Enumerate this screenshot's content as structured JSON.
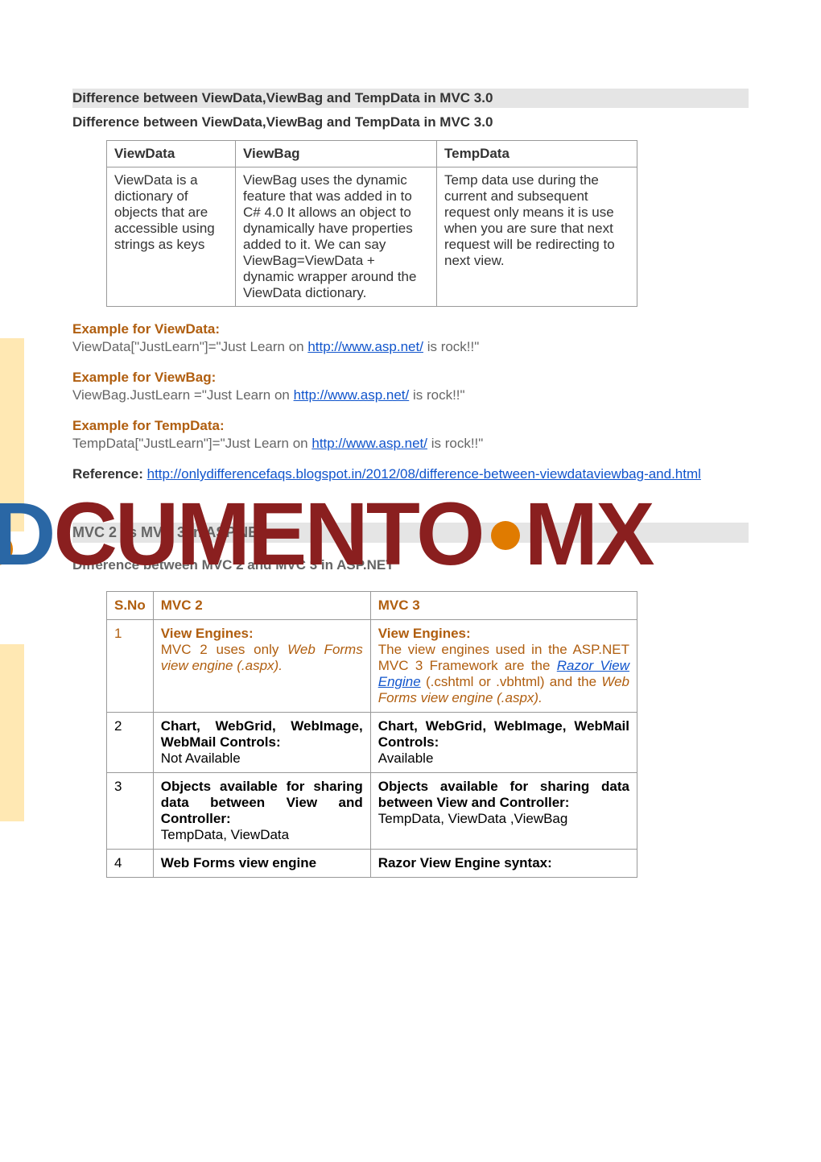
{
  "heading1": "Difference between ViewData,ViewBag and TempData in MVC 3.0",
  "subheading1": "Difference between ViewData,ViewBag and TempData in MVC 3.0",
  "table1": {
    "headers": [
      "ViewData",
      "ViewBag",
      "TempData"
    ],
    "cells": [
      "ViewData is a dictionary of objects that are accessible using strings as keys",
      "ViewBag uses the dynamic feature that was added in to C# 4.0 It allows an object to dynamically have properties added to it. We can say ViewBag=ViewData + dynamic wrapper around the ViewData dictionary.",
      "Temp data use during the current and subsequent request only means it is use when you are sure that next request will be redirecting to next view."
    ]
  },
  "ex_viewdata_label": "Example for ViewData:",
  "ex_viewdata_pre": "ViewData[\"JustLearn\"]=\"Just Learn on ",
  "ex_viewdata_link": "http://www.asp.net/",
  "ex_viewdata_post": " is rock!!\"",
  "ex_viewbag_label": "Example for ViewBag:",
  "ex_viewbag_pre": "ViewBag.JustLearn =\"Just Learn on ",
  "ex_viewbag_link": "http://www.asp.net/",
  "ex_viewbag_post": " is rock!!\"",
  "ex_tempdata_label": "Example for TempData:",
  "ex_tempdata_pre": "TempData[\"JustLearn\"]=\"Just Learn on ",
  "ex_tempdata_link": "http://www.asp.net/",
  "ex_tempdata_post": " is rock!!\"",
  "ref_label": "Reference: ",
  "ref_link": "http://onlydifferencefaqs.blogspot.in/2012/08/difference-between-viewdataviewbag-and.html",
  "heading2": "MVC 2 vs MVC 3 in ASP.NET",
  "subheading2": "Difference between MVC 2 and MVC 3 in ASP.NET",
  "table2": {
    "headers": [
      "S.No",
      "MVC 2",
      "MVC 3"
    ],
    "rows": [
      {
        "sno": "1",
        "mvc2_bold": "View Engines:",
        "mvc2_text1": "MVC 2 uses only ",
        "mvc2_italic1": "Web Forms view engine (.aspx).",
        "mvc3_bold": "View Engines:",
        "mvc3_text1": "The view engines used in the ASP.NET MVC 3 Framework are the ",
        "mvc3_link1": "Razor View Engine",
        "mvc3_text2": " (.cshtml or .vbhtml) and the ",
        "mvc3_italic1": "Web Forms view engine (.aspx)."
      },
      {
        "sno": "2",
        "mvc2_bold": "Chart, WebGrid, WebImage, WebMail Controls:",
        "mvc2_text1": "Not Available",
        "mvc3_bold": "Chart, WebGrid, WebImage, WebMail Controls:",
        "mvc3_text1": "Available"
      },
      {
        "sno": "3",
        "mvc2_bold": "Objects available for sharing data between View and Controller:",
        "mvc2_text1": "TempData, ViewData",
        "mvc3_bold": "Objects available for sharing data between View and Controller:",
        "mvc3_text1": "TempData, ViewData ,ViewBag"
      },
      {
        "sno": "4",
        "mvc2_bold": "Web Forms view engine",
        "mvc3_bold": "Razor View Engine syntax:"
      }
    ]
  },
  "watermark": {
    "d": "D",
    "rest": "CUMENTO",
    "mx": "MX"
  }
}
